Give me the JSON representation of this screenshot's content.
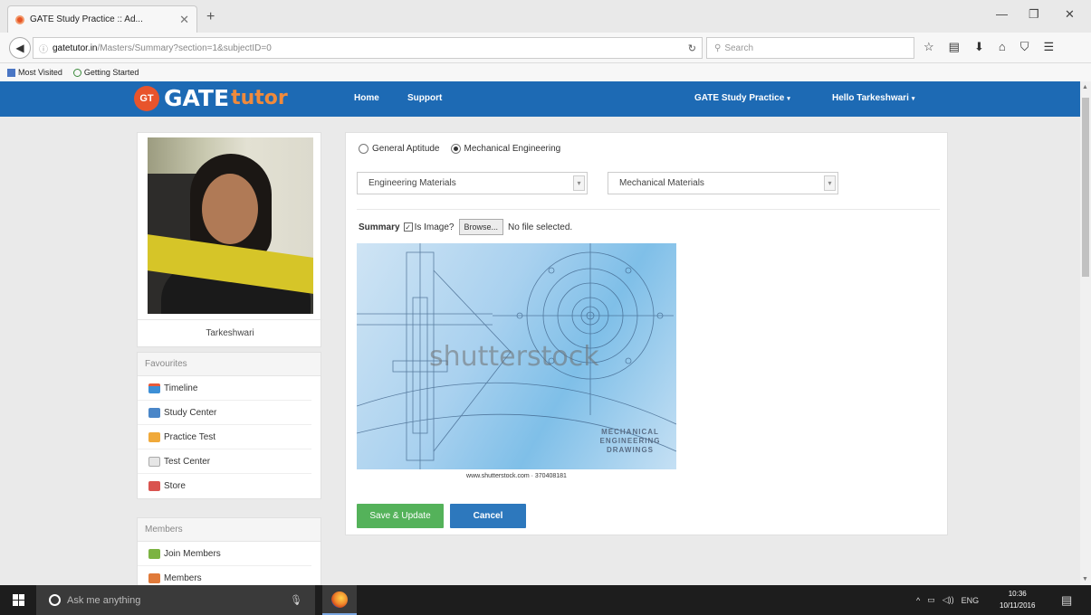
{
  "browser": {
    "tab_title": "GATE Study Practice :: Ad...",
    "url_host": "gatetutor.in",
    "url_path": "/Masters/Summary?section=1&subjectID=0",
    "search_placeholder": "Search",
    "bookmarks": [
      "Most Visited",
      "Getting Started"
    ]
  },
  "site": {
    "logo_prefix": "GT",
    "logo_gate": "GATE",
    "logo_tutor": "tutor",
    "nav": {
      "home": "Home",
      "support": "Support",
      "practice": "GATE Study Practice",
      "user": "Hello Tarkeshwari"
    }
  },
  "profile": {
    "name": "Tarkeshwari"
  },
  "favourites": {
    "title": "Favourites",
    "items": [
      "Timeline",
      "Study Center",
      "Practice Test",
      "Test Center",
      "Store"
    ]
  },
  "members": {
    "title": "Members",
    "items": [
      "Join Members",
      "Members"
    ]
  },
  "form": {
    "radio_options": [
      "General Aptitude",
      "Mechanical Engineering"
    ],
    "selected_radio": "Mechanical Engineering",
    "select1_value": "Engineering Materials",
    "select2_value": "Mechanical Materials",
    "summary_label": "Summary",
    "is_image_label": "Is Image?",
    "is_image_checked": true,
    "browse_label": "Browse...",
    "file_status": "No file selected.",
    "image_watermark": "shutterstock",
    "image_caption": "MECHANICAL ENGINEERING DRAWINGS",
    "image_credit": "www.shutterstock.com · 370408181",
    "save_label": "Save & Update",
    "cancel_label": "Cancel"
  },
  "taskbar": {
    "search_placeholder": "Ask me anything",
    "lang": "ENG",
    "time": "10:36",
    "date": "10/11/2016"
  },
  "colors": {
    "header_blue": "#1d6ab4",
    "save_green": "#54b25a",
    "cancel_blue": "#2d78bd",
    "logo_orange": "#e8542c"
  }
}
